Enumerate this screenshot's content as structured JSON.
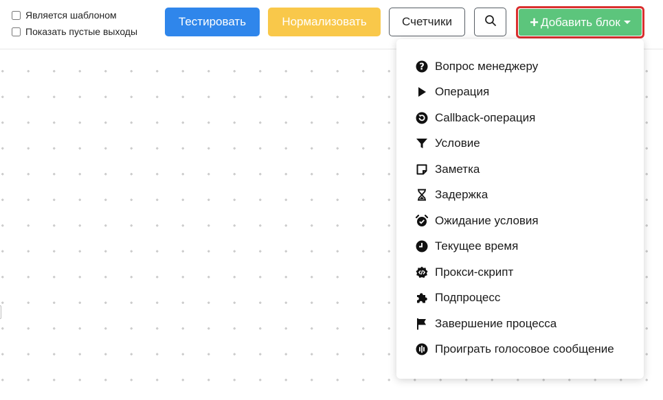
{
  "toolbar": {
    "checkboxes": [
      {
        "label": "Является шаблоном",
        "checked": false
      },
      {
        "label": "Показать пустые выходы",
        "checked": false
      }
    ],
    "test_label": "Тестировать",
    "normalize_label": "Нормализовать",
    "counters_label": "Счетчики",
    "search_icon": "search-icon",
    "add_block_label": "Добавить блок",
    "add_block_icon": "plus-icon",
    "colors": {
      "test": "#2f86eb",
      "normalize": "#f9c84a",
      "add_block": "#5cc57c",
      "add_block_highlight": "#d92e2e"
    }
  },
  "menu": {
    "items": [
      {
        "label": "Вопрос менеджеру",
        "icon": "question-circle-icon"
      },
      {
        "label": "Операция",
        "icon": "play-icon"
      },
      {
        "label": "Callback-операция",
        "icon": "callback-icon"
      },
      {
        "label": "Условие",
        "icon": "filter-icon"
      },
      {
        "label": "Заметка",
        "icon": "note-icon"
      },
      {
        "label": "Задержка",
        "icon": "hourglass-icon"
      },
      {
        "label": "Ожидание условия",
        "icon": "alarm-check-icon"
      },
      {
        "label": "Текущее время",
        "icon": "clock-icon"
      },
      {
        "label": "Прокси-скрипт",
        "icon": "code-badge-icon"
      },
      {
        "label": "Подпроцесс",
        "icon": "puzzle-icon"
      },
      {
        "label": "Завершение процесса",
        "icon": "flag-icon"
      },
      {
        "label": "Проиграть голосовое сообщение",
        "icon": "voice-message-icon"
      }
    ]
  }
}
